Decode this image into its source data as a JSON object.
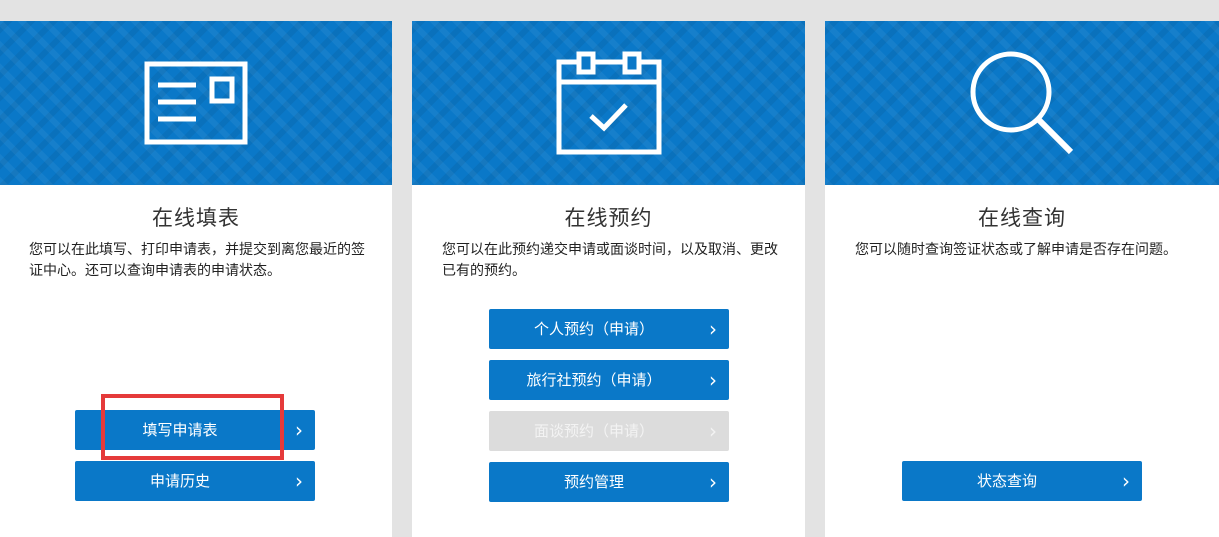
{
  "cards": [
    {
      "icon": "application-form-icon",
      "title": "在线填表",
      "description": "您可以在此填写、打印申请表，并提交到离您最近的签证中心。还可以查询申请表的申请状态。",
      "buttons": [
        {
          "label": "填写申请表",
          "chevron": "›",
          "disabled": false
        },
        {
          "label": "申请历史",
          "chevron": "›",
          "disabled": false
        }
      ]
    },
    {
      "icon": "calendar-check-icon",
      "title": "在线预约",
      "description": "您可以在此预约递交申请或面谈时间，以及取消、更改已有的预约。",
      "buttons": [
        {
          "label": "个人预约（申请）",
          "chevron": "›",
          "disabled": false
        },
        {
          "label": "旅行社预约（申请）",
          "chevron": "›",
          "disabled": false
        },
        {
          "label": "面谈预约（申请）",
          "chevron": "›",
          "disabled": true
        },
        {
          "label": "预约管理",
          "chevron": "›",
          "disabled": false
        }
      ]
    },
    {
      "icon": "search-icon",
      "title": "在线查询",
      "description": "您可以随时查询签证状态或了解申请是否存在问题。",
      "buttons": [
        {
          "label": "状态查询",
          "chevron": "›",
          "disabled": false
        }
      ]
    }
  ],
  "colors": {
    "brand_blue": "#0a78c8",
    "disabled_gray": "#dcdcdc",
    "highlight_red": "#e53a3a",
    "background": "#e3e3e3"
  }
}
